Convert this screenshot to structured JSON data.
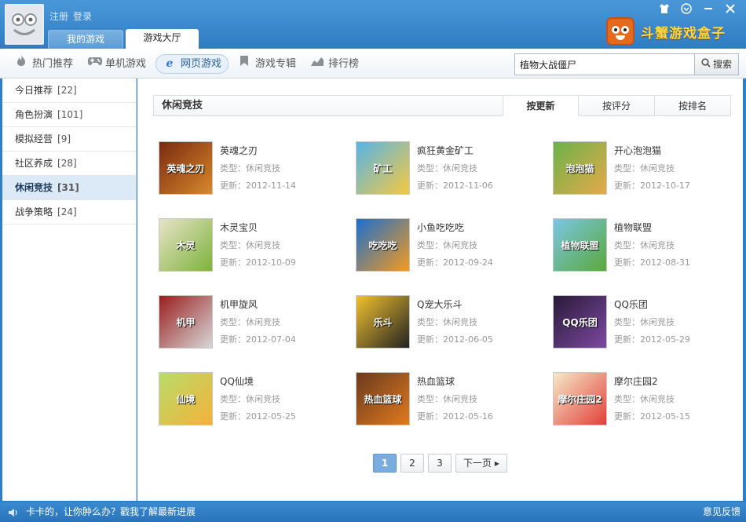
{
  "header": {
    "register": "注册",
    "login": "登录",
    "tabs": [
      "我的游戏",
      "游戏大厅"
    ],
    "brand": "斗蟹游戏盒子",
    "controls": [
      "shirt-icon",
      "settings-icon",
      "minimize-icon",
      "close-icon"
    ]
  },
  "toolbar": {
    "nav": [
      {
        "label": "热门推荐",
        "icon": "flame-icon"
      },
      {
        "label": "单机游戏",
        "icon": "gamepad-icon"
      },
      {
        "label": "网页游戏",
        "icon": "ie-icon"
      },
      {
        "label": "游戏专辑",
        "icon": "bookmark-icon"
      },
      {
        "label": "排行榜",
        "icon": "chart-icon"
      }
    ],
    "search_value": "植物大战僵尸",
    "search_button": "搜索"
  },
  "sidebar": {
    "items": [
      {
        "label": "今日推荐",
        "count": "[22]"
      },
      {
        "label": "角色扮演",
        "count": "[101]"
      },
      {
        "label": "模拟经营",
        "count": "[9]"
      },
      {
        "label": "社区养成",
        "count": "[28]"
      },
      {
        "label": "休闲竞技",
        "count": "[31]"
      },
      {
        "label": "战争策略",
        "count": "[24]"
      }
    ],
    "active_index": 4
  },
  "main": {
    "section_title": "休闲竞技",
    "sort_tabs": [
      "按更新",
      "按评分",
      "按排名"
    ],
    "games": [
      {
        "name": "英魂之刃",
        "type": "类型：休闲竞技",
        "date": "更新：2012-11-14",
        "thumb_text": "英魂之刃",
        "bg": "#7a2a10",
        "bg2": "#d8882a"
      },
      {
        "name": "疯狂黄金矿工",
        "type": "类型：休闲竞技",
        "date": "更新：2012-11-06",
        "thumb_text": "矿工",
        "bg": "#56b4e8",
        "bg2": "#f6c940"
      },
      {
        "name": "开心泡泡猫",
        "type": "类型：休闲竞技",
        "date": "更新：2012-10-17",
        "thumb_text": "泡泡猫",
        "bg": "#6bb24a",
        "bg2": "#e7a94a"
      },
      {
        "name": "木灵宝贝",
        "type": "类型：休闲竞技",
        "date": "更新：2012-10-09",
        "thumb_text": "木灵",
        "bg": "#e9e3c8",
        "bg2": "#7cb33a"
      },
      {
        "name": "小鱼吃吃吃",
        "type": "类型：休闲竞技",
        "date": "更新：2012-09-24",
        "thumb_text": "吃吃吃",
        "bg": "#1b6fd0",
        "bg2": "#f49a1e"
      },
      {
        "name": "植物联盟",
        "type": "类型：休闲竞技",
        "date": "更新：2012-08-31",
        "thumb_text": "植物联盟",
        "bg": "#7ac6e6",
        "bg2": "#5aa93b"
      },
      {
        "name": "机甲旋风",
        "type": "类型：休闲竞技",
        "date": "更新：2012-07-04",
        "thumb_text": "机甲",
        "bg": "#9a1d1d",
        "bg2": "#d8d8d8"
      },
      {
        "name": "Q宠大乐斗",
        "type": "类型：休闲竞技",
        "date": "更新：2012-06-05",
        "thumb_text": "乐斗",
        "bg": "#f2c12e",
        "bg2": "#222222"
      },
      {
        "name": "QQ乐团",
        "type": "类型：休闲竞技",
        "date": "更新：2012-05-29",
        "thumb_text": "QQ乐团",
        "bg": "#2a1a3a",
        "bg2": "#7c4aa0"
      },
      {
        "name": "QQ仙境",
        "type": "类型：休闲竞技",
        "date": "更新：2012-05-25",
        "thumb_text": "仙境",
        "bg": "#b8dc6a",
        "bg2": "#f4b23a"
      },
      {
        "name": "热血篮球",
        "type": "类型：休闲竞技",
        "date": "更新：2012-05-16",
        "thumb_text": "热血篮球",
        "bg": "#6b3a1e",
        "bg2": "#e07a1e"
      },
      {
        "name": "摩尔庄园2",
        "type": "类型：休闲竞技",
        "date": "更新：2012-05-15",
        "thumb_text": "摩尔庄园2",
        "bg": "#f6e9c8",
        "bg2": "#e2403a"
      }
    ],
    "pager": {
      "pages": [
        "1",
        "2",
        "3"
      ],
      "next": "下一页",
      "active": "1"
    }
  },
  "statusbar": {
    "news": "卡卡的，让你肿么办？戳我了解最新进展",
    "feedback": "意见反馈"
  },
  "colors": {
    "titlebar": "#3a8ad0",
    "accent": "#2f7cc3",
    "active_page": "#79ade0",
    "brand_orange": "#e66a1c"
  }
}
